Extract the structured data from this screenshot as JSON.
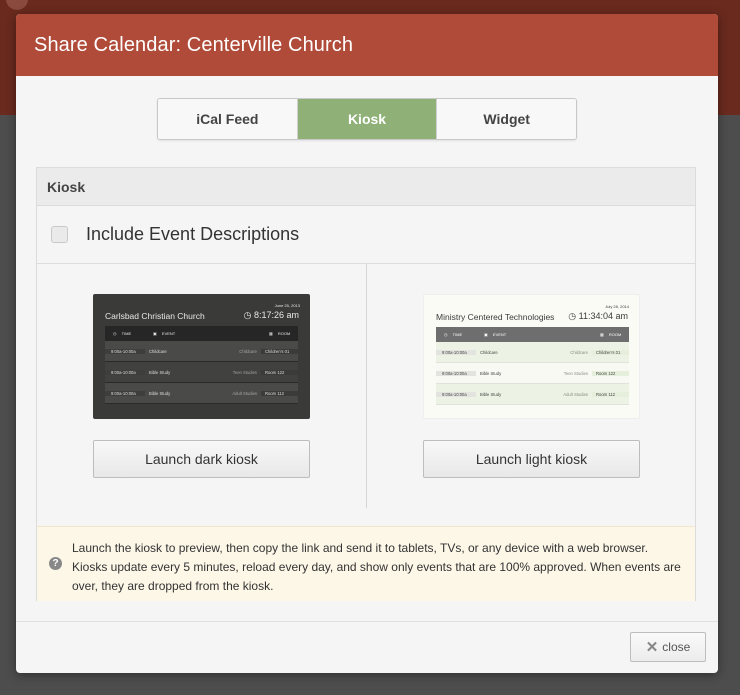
{
  "modal": {
    "title": "Share Calendar: Centerville Church"
  },
  "tabs": [
    {
      "label": "iCal Feed",
      "active": false
    },
    {
      "label": "Kiosk",
      "active": true
    },
    {
      "label": "Widget",
      "active": false
    }
  ],
  "panel": {
    "heading": "Kiosk",
    "option_label": "Include Event Descriptions",
    "option_checked": false
  },
  "dark_preview": {
    "date": "June 25, 2013",
    "church": "Carlsbad Christian Church",
    "time": "8:17:26 am",
    "headers": {
      "time": "TIME",
      "event": "EVENT",
      "room": "ROOM"
    },
    "rows": [
      {
        "time": "9:00a-10:00a",
        "event": "Childcare",
        "category": "Childcare",
        "room": "Children's 01"
      },
      {
        "time": "9:00a-10:00a",
        "event": "Bible Study",
        "category": "Teen Studies",
        "room": "Room 122"
      },
      {
        "time": "9:00a-10:00a",
        "event": "Bible Study",
        "category": "Adult Studies",
        "room": "Room 112"
      }
    ]
  },
  "light_preview": {
    "date": "July 28, 2014",
    "church": "Ministry Centered Technologies",
    "time": "11:34:04 am",
    "headers": {
      "time": "TIME",
      "event": "EVENT",
      "room": "ROOM"
    },
    "rows": [
      {
        "time": "9:00a-10:00a",
        "event": "Childcare",
        "category": "Childcare",
        "room": "Children's 01"
      },
      {
        "time": "9:00a-10:00a",
        "event": "Bible Study",
        "category": "Teen Studies",
        "room": "Room 122"
      },
      {
        "time": "9:00a-10:00a",
        "event": "Bible Study",
        "category": "Adult Studies",
        "room": "Room 112"
      }
    ]
  },
  "buttons": {
    "launch_dark": "Launch dark kiosk",
    "launch_light": "Launch light kiosk",
    "close": "close"
  },
  "info": {
    "text": "Launch the kiosk to preview, then copy the link and send it to tablets, TVs, or any device with a web browser. Kiosks update every 5 minutes, reload every day, and show only events that are 100% approved. When events are over, they are dropped from the kiosk."
  },
  "colors": {
    "header": "#b04b3a",
    "active_tab": "#8fb178",
    "info_bg": "#fdf7e8"
  },
  "icons": [
    "clock-icon",
    "calendar-icon",
    "grid-icon",
    "help-icon",
    "close-icon"
  ]
}
